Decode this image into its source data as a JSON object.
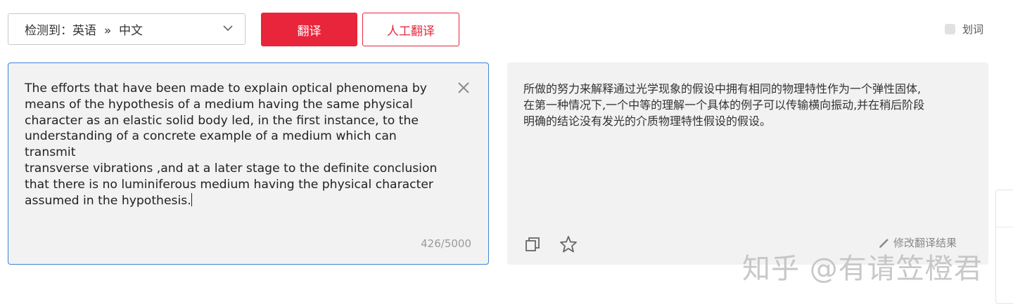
{
  "language_selector": {
    "prefix": "检测到：",
    "source_lang": "英语",
    "separator": "»",
    "target_lang": "中文"
  },
  "toolbar": {
    "translate_label": "翻译",
    "human_translate_label": "人工翻译",
    "word_pick_label": "划词"
  },
  "source": {
    "lines": [
      "The efforts that have been made to explain optical phenomena by",
      "means of the hypothesis of a medium having the same physical",
      "character as an elastic solid body led, in the first instance, to the",
      "understanding of a concrete example of a medium which can transmit",
      "transverse vibrations ,and at a later stage to the definite conclusion",
      "that there is no luminiferous medium having the physical character",
      "assumed in the hypothesis."
    ],
    "char_count": "426/5000"
  },
  "target": {
    "lines": [
      "所做的努力来解释通过光学现象的假设中拥有相同的物理特性作为一个弹性固体,",
      "在第一种情况下,一个中等的理解一个具体的例子可以传输横向振动,并在稍后阶段",
      "明确的结论没有发光的介质物理特性假设的假设。"
    ],
    "edit_label": "修改翻译结果"
  },
  "watermark": "知乎 @有请笠橙君",
  "colors": {
    "accent": "#e8253a",
    "focus_border": "#3d84d6",
    "panel_bg": "#f2f2f2"
  }
}
